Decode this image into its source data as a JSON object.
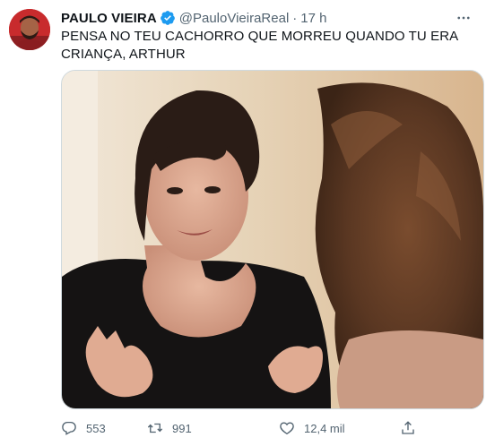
{
  "tweet": {
    "author_name": "PAULO VIEIRA",
    "handle": "@PauloVieiraReal",
    "separator": "·",
    "time": "17 h",
    "text": "PENSA NO TEU CACHORRO QUE MORREU QUANDO TU ERA CRIANÇA, ARTHUR",
    "verified": true
  },
  "actions": {
    "replies": "553",
    "retweets": "991",
    "likes": "12,4 mil"
  },
  "icons": {
    "verified": "verified-badge-icon",
    "more": "more-options-icon",
    "reply": "reply-icon",
    "retweet": "retweet-icon",
    "like": "heart-icon",
    "share": "share-icon"
  },
  "colors": {
    "verified_blue": "#1d9bf0",
    "secondary_text": "#536471",
    "primary_text": "#0f1419",
    "avatar_bg": "#c4262a"
  }
}
